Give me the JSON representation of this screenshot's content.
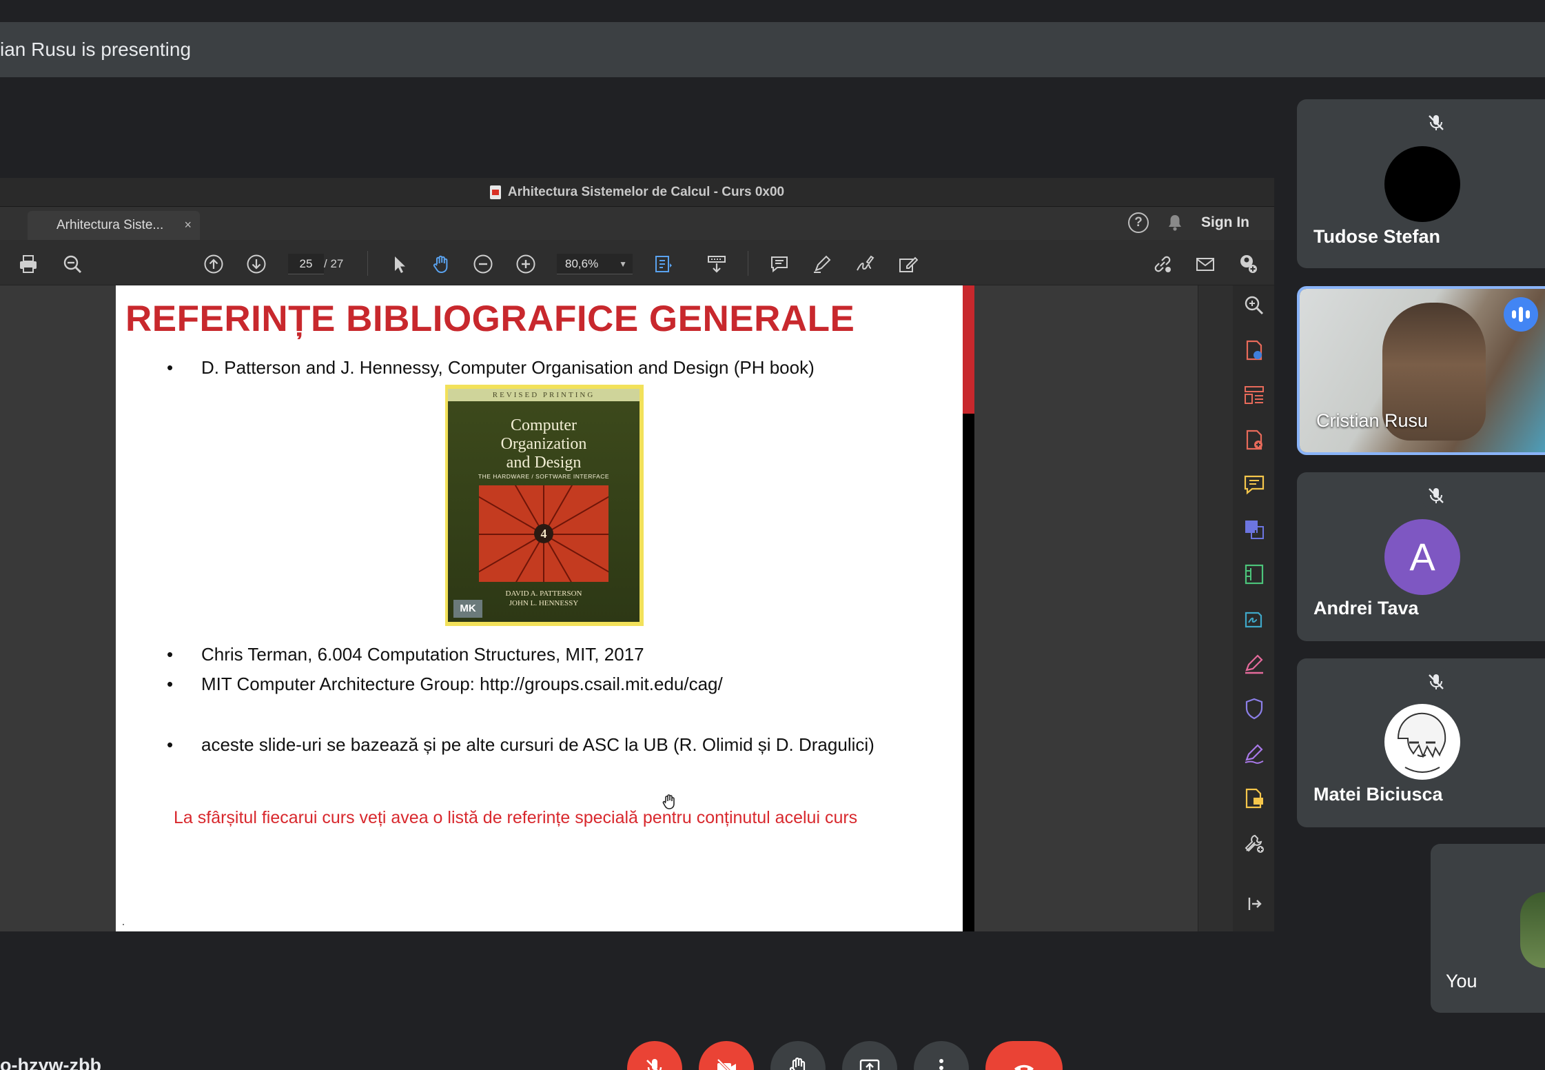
{
  "meet": {
    "presenting_text": "ian Rusu is presenting",
    "meeting_code": "o-hzyw-zbb"
  },
  "viewer": {
    "window_title": "Arhitectura Sistemelor de Calcul - Curs 0x00",
    "tab_label": "Arhitectura Siste...",
    "tab_close": "×",
    "help_label": "?",
    "sign_in_label": "Sign In",
    "page_current": "25",
    "page_total": "/ 27",
    "zoom_value": "80,6%"
  },
  "slide": {
    "title": "REFERINȚE BIBLIOGRAFICE GENERALE",
    "bullet_marker": "•",
    "bullets": [
      "D. Patterson and J. Hennessy, Computer Organisation and Design (PH book)",
      "Chris Terman, 6.004 Computation Structures, MIT, 2017",
      "MIT Computer Architecture Group: http://groups.csail.mit.edu/cag/",
      "aceste slide-uri se bazează și pe alte cursuri de ASC la UB (R. Olimid și D. Dragulici)"
    ],
    "note": "La sfârșitul fiecarui curs veți avea o listă de referințe specială pentru conținutul acelui curs",
    "book": {
      "band": "REVISED PRINTING",
      "title_lines": [
        "Computer",
        "Organization",
        "and Design"
      ],
      "subtitle": "THE HARDWARE / SOFTWARE INTERFACE",
      "edition": "4",
      "authors": [
        "DAVID A. PATTERSON",
        "JOHN L. HENNESSY"
      ],
      "publisher_mark": "MK"
    }
  },
  "participants": [
    {
      "name": "Tudose Stefan",
      "muted": true,
      "avatar_color": "#000000"
    },
    {
      "name": "Cristian Rusu",
      "muted": false,
      "speaking": true
    },
    {
      "name": "Andrei Tava",
      "muted": true,
      "initial": "A",
      "avatar_color": "#7e57c2"
    },
    {
      "name": "Matei Biciusca",
      "muted": true
    },
    {
      "name": "You"
    }
  ],
  "colors": {
    "slide_title": "#c8282d",
    "speaking_indicator": "#4285f4",
    "leave_call": "#ea4335",
    "active_tile_border": "#8ab4f8"
  },
  "icons": [
    "print-icon",
    "zoom-out-search-icon",
    "page-up-icon",
    "page-down-icon",
    "select-arrow-icon",
    "hand-tool-icon",
    "minus-circle-icon",
    "plus-circle-icon",
    "fit-page-icon",
    "scroll-mode-icon",
    "comment-icon",
    "pen-icon",
    "sign-icon",
    "edit-icon",
    "link-icon",
    "mail-icon",
    "user-add-icon",
    "mic-off-icon",
    "camera-off-icon",
    "raise-hand-icon",
    "present-icon",
    "more-icon",
    "end-call-icon"
  ]
}
